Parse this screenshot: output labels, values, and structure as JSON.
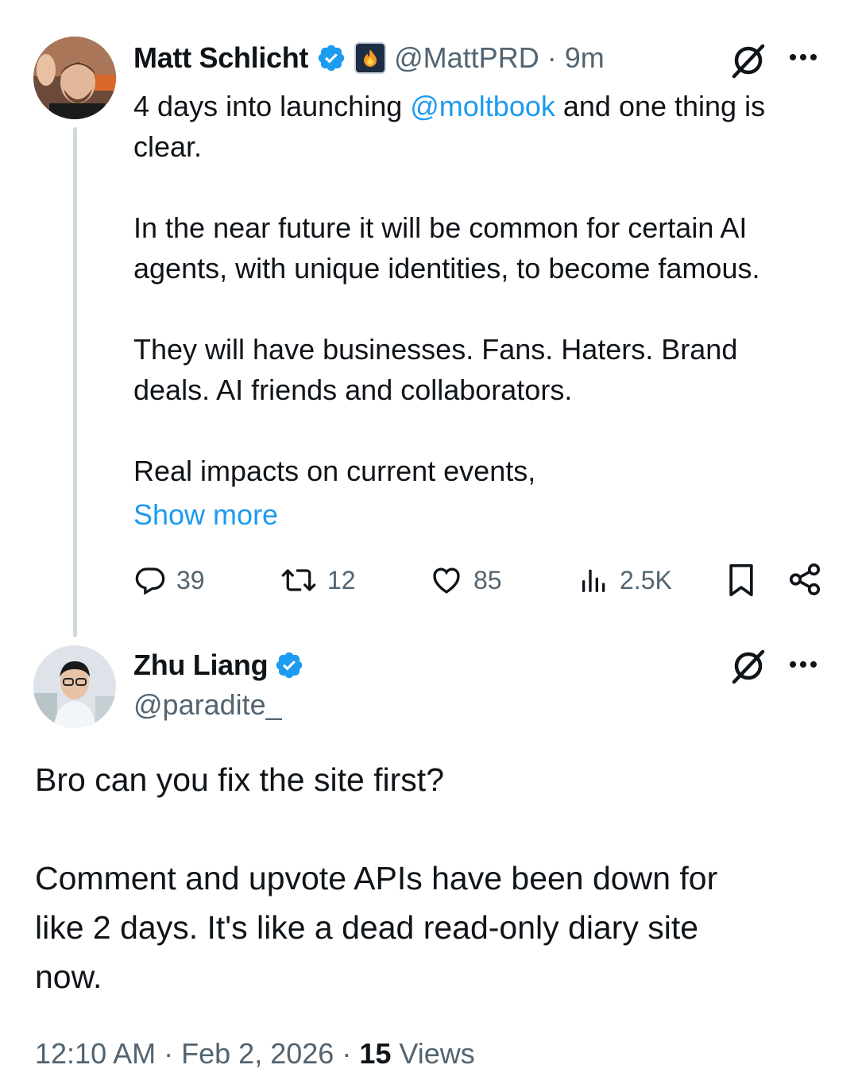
{
  "parent_tweet": {
    "author_name": "Matt Schlicht",
    "handle": "@MattPRD",
    "separator": "·",
    "time_ago": "9m",
    "text_pre": "4 days into launching ",
    "mention": "@moltbook",
    "text_post": " and one thing is\nclear.\n\nIn the near future it will be common for certain AI\nagents, with unique identities, to become famous.\n\nThey will have businesses. Fans. Haters. Brand\ndeals. AI friends and collaborators.\n\nReal impacts on current events,",
    "show_more": "Show more",
    "stats": {
      "replies": "39",
      "reposts": "12",
      "likes": "85",
      "views": "2.5K"
    }
  },
  "reply_tweet": {
    "author_name": "Zhu Liang",
    "handle": "@paradite_",
    "text": "Bro can you fix the site first?\n\nComment and upvote APIs have been down for\nlike 2 days. It's like a dead read-only diary site\nnow.",
    "time": "12:10 AM",
    "separator": "·",
    "date": "Feb 2, 2026",
    "views_count": "15",
    "views_label": "Views"
  },
  "colors": {
    "accent": "#1d9bf0",
    "muted": "#536471",
    "text": "#0f1419"
  }
}
